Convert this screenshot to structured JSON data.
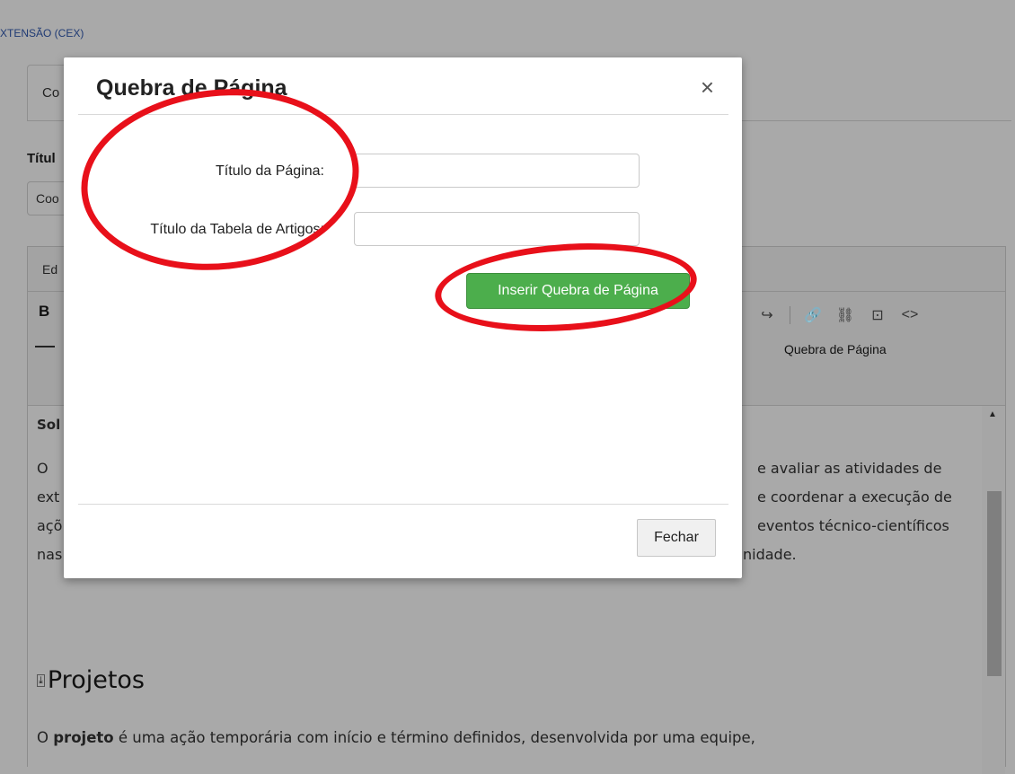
{
  "background": {
    "breadcrumb": "XTENSÃO (CEX)",
    "tab_label": "Co",
    "title_label": "Títul",
    "title_input_value": "Coo",
    "editor_header": "Ed",
    "toolbar": {
      "bold_label": "B",
      "icons": [
        "redo-icon",
        "link-icon",
        "unlink-icon",
        "bookmark-icon",
        "source-code-icon"
      ],
      "redo_glyph": "↪",
      "link_glyph": "🔗",
      "unlink_glyph": "⛓",
      "bookmark_glyph": "⊡",
      "code_glyph": "<>",
      "page_break_label": "Quebra de Página"
    },
    "content": {
      "sol_fragment": "Sol",
      "line1_left": "O",
      "line1_right": "e avaliar as atividades de",
      "line2_left": "ext",
      "line2_right": "e coordenar a execução de",
      "line3_left": "açõ",
      "line3_right": "eventos técnico-científicos",
      "line4_left": "nas",
      "line4_right": "nidade.",
      "heading_icon_glyph": "⤓",
      "heading": "Projetos",
      "last_line_bold": "projeto",
      "last_line_start": "O",
      "last_line_rest": "é uma ação temporária com início e término definidos, desenvolvida por uma equipe,"
    },
    "scroll_up_glyph": "▲"
  },
  "modal": {
    "title": "Quebra de Página",
    "close_glyph": "×",
    "fields": [
      {
        "label": "Título da Página:",
        "value": ""
      },
      {
        "label": "Título da Tabela de Artigos:",
        "value": ""
      }
    ],
    "insert_button": "Inserir Quebra de Página",
    "footer_close_button": "Fechar"
  },
  "colors": {
    "annotation": "#e8101a",
    "primary_green": "#4cae4c",
    "overlay": "#a9a9a9"
  }
}
